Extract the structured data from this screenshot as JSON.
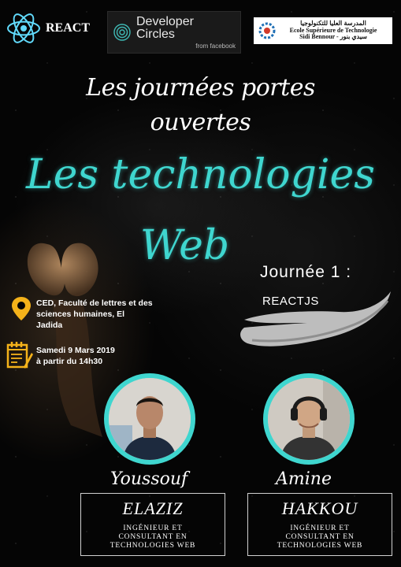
{
  "logos": {
    "react": {
      "text": "REACT",
      "icon": "react-atom-icon"
    },
    "developer_circles": {
      "title": "Developer Circles",
      "subtitle": "from facebook",
      "icon": "developer-circles-icon"
    },
    "school": {
      "arabic": "المدرسة العليا للتكنولوجيا",
      "line1": "Ecole Supérieure de Technologie",
      "line2": "Sidi Bennour - سيدي بنور",
      "icon": "school-gear-icon"
    }
  },
  "headline": {
    "line1": "Les journées portes",
    "line2": "ouvertes",
    "topic_line1": "Les technologies",
    "topic_line2": "Web"
  },
  "session": {
    "day": "Journée 1 :",
    "subject": "REACTJS"
  },
  "event": {
    "location_icon": "location-pin-icon",
    "location_line1": "CED, Faculté de lettres et des",
    "location_line2": "sciences humaines, El",
    "location_line3": "Jadida",
    "calendar_icon": "calendar-icon",
    "date_line1": "Samedi 9 Mars 2019",
    "date_line2": "à partir du 14h30"
  },
  "speakers": [
    {
      "first_name": "Youssouf",
      "last_name": "ELAZIZ",
      "role_line1": "INGÉNIEUR ET",
      "role_line2": "CONSULTANT EN",
      "role_line3": "TECHNOLOGIES WEB"
    },
    {
      "first_name": "Amine",
      "last_name": "HAKKOU",
      "role_line1": "INGÉNIEUR ET",
      "role_line2": "CONSULTANT EN",
      "role_line3": "TECHNOLOGIES WEB"
    }
  ],
  "colors": {
    "accent": "#3fd6cf",
    "background": "#050505",
    "text": "#ffffff"
  }
}
